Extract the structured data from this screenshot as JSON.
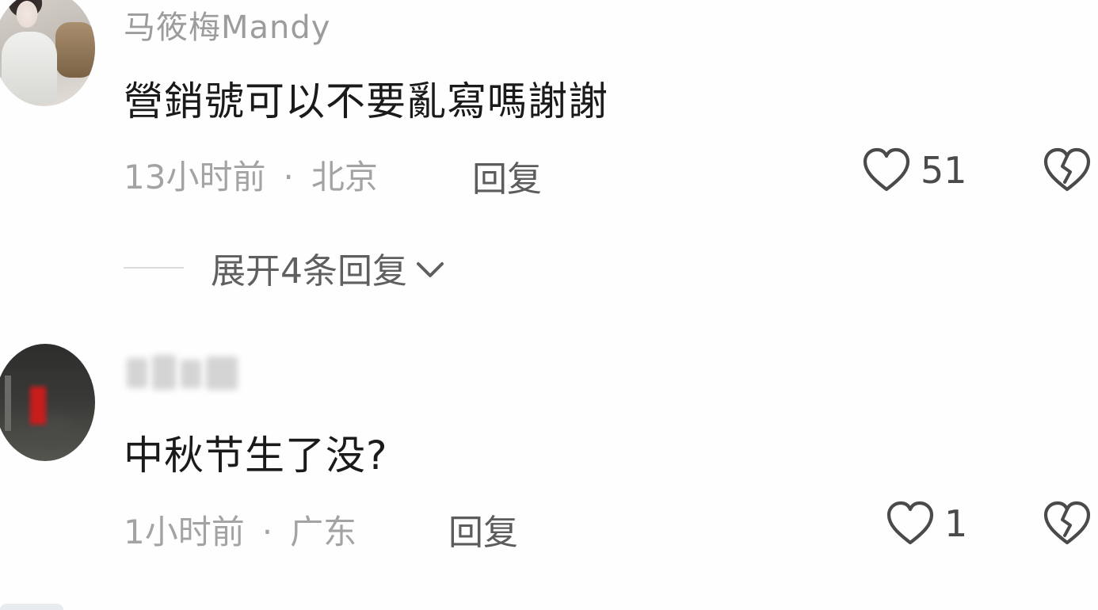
{
  "comments": [
    {
      "username": "马筱梅Mandy",
      "text": "營銷號可以不要亂寫嗎謝謝",
      "time": "13小时前",
      "separator": "·",
      "location": "北京",
      "reply_label": "回复",
      "like_count": "51",
      "expand_label": "展开4条回复"
    },
    {
      "username": "",
      "text": "中秋节生了没?",
      "time": "1小时前",
      "separator": "·",
      "location": "广东",
      "reply_label": "回复",
      "like_count": "1"
    }
  ],
  "icons": {
    "like": "heart-outline-icon",
    "dislike": "broken-heart-icon",
    "expand": "chevron-down-icon"
  },
  "colors": {
    "text_primary": "#1a1a1a",
    "text_secondary": "#a3a3a3",
    "icon": "#4a4a4a"
  }
}
